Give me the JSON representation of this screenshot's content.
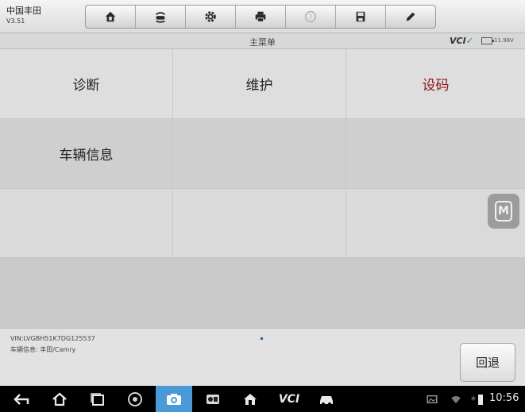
{
  "app": {
    "brand": "中国丰田",
    "version": "V3.51"
  },
  "toolbar": {
    "items": [
      {
        "name": "home-icon"
      },
      {
        "name": "vehicle-swap-icon"
      },
      {
        "name": "settings-icon"
      },
      {
        "name": "print-icon"
      },
      {
        "name": "help-icon",
        "disabled": true
      },
      {
        "name": "save-icon"
      },
      {
        "name": "edit-icon"
      }
    ]
  },
  "subbar": {
    "title": "主菜单",
    "vci_label": "VCI",
    "voltage": "11.98V"
  },
  "menu": {
    "cells": [
      {
        "label": "诊断",
        "row": "a"
      },
      {
        "label": "维护",
        "row": "a"
      },
      {
        "label": "设码",
        "row": "a",
        "highlight": true
      },
      {
        "label": "车辆信息",
        "row": "b"
      },
      {
        "label": "",
        "row": "b"
      },
      {
        "label": "",
        "row": "b"
      },
      {
        "label": "",
        "row": "c"
      },
      {
        "label": "",
        "row": "c"
      },
      {
        "label": "",
        "row": "c"
      },
      {
        "label": "",
        "row": "d"
      },
      {
        "label": "",
        "row": "d"
      },
      {
        "label": "",
        "row": "d"
      }
    ]
  },
  "side_tab": {
    "letter": "M"
  },
  "info": {
    "vin": "VIN:LVGBH51K7DG125537",
    "vehicle": "车辆信息: 丰田/Camry",
    "back_button": "回退"
  },
  "navbar": {
    "vci_label": "VCI",
    "time": "10:56"
  },
  "colors": {
    "highlight_text": "#8b1a1a",
    "camera_active": "#4a9ad8",
    "vci_accent": "#2e9a2e"
  }
}
